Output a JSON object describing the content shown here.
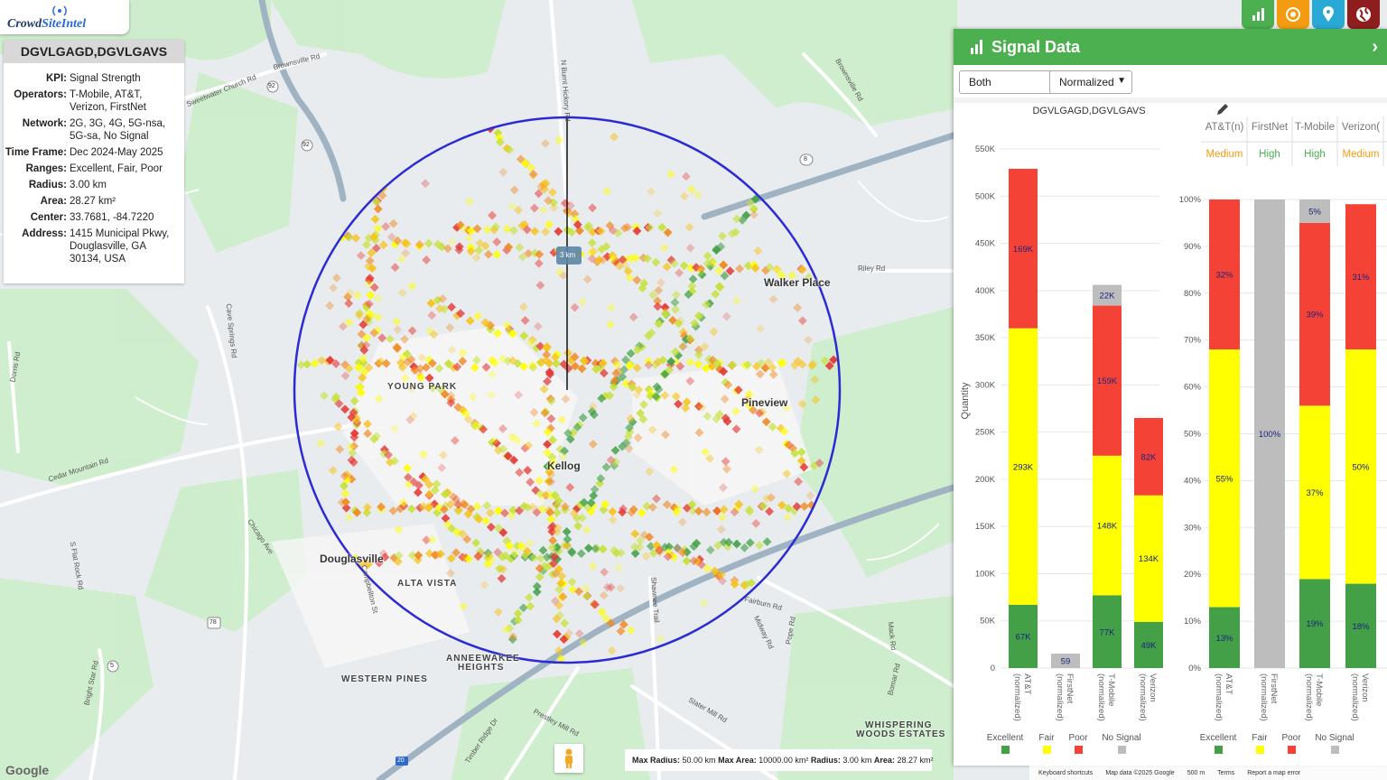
{
  "app": {
    "logo_crowd": "Crowd",
    "logo_intel": "SiteIntel"
  },
  "info": {
    "title": "DGVLGAGD,DGVLGAVS",
    "rows": [
      {
        "k": "KPI:",
        "v": "Signal Strength"
      },
      {
        "k": "Operators:",
        "v": "T-Mobile, AT&T, Verizon, FirstNet"
      },
      {
        "k": "Network:",
        "v": "2G, 3G, 4G, 5G-nsa, 5G-sa, No Signal"
      },
      {
        "k": "Time Frame:",
        "v": "Dec 2024-May 2025"
      },
      {
        "k": "Ranges:",
        "v": "Excellent, Fair, Poor"
      },
      {
        "k": "Radius:",
        "v": "3.00 km"
      },
      {
        "k": "Area:",
        "v": "28.27 km²"
      },
      {
        "k": "Center:",
        "v": "33.7681, -84.7220"
      },
      {
        "k": "Address:",
        "v": "1415 Municipal Pkwy, Douglasville, GA 30134, USA"
      }
    ]
  },
  "toolbar": {
    "icons": [
      "bar-chart-icon",
      "target-icon",
      "location-pin-icon",
      "globe-icon"
    ],
    "colors": [
      "#4caf50",
      "#f39c12",
      "#29a9d6",
      "#8e1e1e"
    ]
  },
  "map": {
    "radius_label": "3 km",
    "places": [
      {
        "name": "Walker Place"
      },
      {
        "name": "Pineview"
      },
      {
        "name": "Kellog"
      },
      {
        "name": "Douglasville"
      }
    ],
    "neighborhoods": [
      "YOUNG PARK",
      "ALTA VISTA",
      "ANNEEWAKEE",
      "HEIGHTS",
      "WESTERN PINES",
      "WHISPERING",
      "WOODS ESTATES"
    ],
    "roads": [
      "Brownsville Rd",
      "Sweetwater Church Rd",
      "N Burnt Hickory Rd",
      "Riley Rd",
      "Cave Springs Rd",
      "Dorris Rd",
      "Cedar Mountain Rd",
      "Chicago Ave",
      "S Flat Rock Rd",
      "Campbellton St",
      "Bright Star Rd",
      "Prestley Mill Rd",
      "Slater Mill Rd",
      "Fairburn Rd",
      "Midway Rd",
      "Pope Rd",
      "Mack Rd",
      "Bomar Rd",
      "Timber Ridge Dr",
      "Shawnee Trail",
      "Brownsville Rd "
    ],
    "shields": [
      "92",
      "92",
      "8",
      "78",
      "5",
      "20"
    ],
    "footer": {
      "max_radius_label": "Max Radius:",
      "max_radius": "50.00 km",
      "max_area_label": "Max Area:",
      "max_area": "10000.00 km²",
      "radius_label": "Radius:",
      "radius": "3.00 km",
      "area_label": "Area:",
      "area": "28.27 km²"
    },
    "google": "Google",
    "attribution": [
      "Keyboard shortcuts",
      "Map data ©2025 Google",
      "500 m",
      "Terms",
      "Report a map error"
    ]
  },
  "panel": {
    "title": "Signal Data",
    "select_mode": "Both",
    "select_scale": "Normalized",
    "chart_title": "DGVLGAGD,DGVLGAVS",
    "legend": [
      "Excellent",
      "Fair",
      "Poor",
      "No Signal"
    ],
    "colors": {
      "excellent": "#43a047",
      "fair": "#ffff00",
      "poor": "#f44336",
      "nosignal": "#bdbdbd"
    },
    "operators_header": [
      {
        "name": "AT&T",
        "sup": "(n)",
        "rating": "Medium",
        "color": "#f39c12"
      },
      {
        "name": "FirstNet",
        "sup": "",
        "rating": "High",
        "color": "#4caf50"
      },
      {
        "name": "T-Mobile",
        "sup": "",
        "rating": "High",
        "color": "#4caf50"
      },
      {
        "name": "Verizon",
        "sup": "(",
        "rating": "Medium",
        "color": "#f39c12"
      }
    ]
  },
  "chart_data": [
    {
      "type": "bar",
      "stacked": true,
      "title": "DGVLGAGD,DGVLGAVS",
      "ylabel": "Quantity",
      "ylim": [
        0,
        550000
      ],
      "yticks": [
        "0",
        "50K",
        "100K",
        "150K",
        "200K",
        "250K",
        "300K",
        "350K",
        "400K",
        "450K",
        "500K",
        "550K"
      ],
      "categories": [
        "AT&T (normalized)",
        "FirstNet (normalized)",
        "T-Mobile (normalized)",
        "Verizon (normalized)"
      ],
      "series": [
        {
          "name": "Excellent",
          "values": [
            67000,
            0,
            77000,
            49000
          ],
          "labels": [
            "67K",
            "",
            "77K",
            "49K"
          ]
        },
        {
          "name": "Fair",
          "values": [
            293000,
            0,
            148000,
            134000
          ],
          "labels": [
            "293K",
            "",
            "148K",
            "134K"
          ]
        },
        {
          "name": "Poor",
          "values": [
            169000,
            0,
            159000,
            82000
          ],
          "labels": [
            "169K",
            "",
            "159K",
            "82K"
          ]
        },
        {
          "name": "No Signal",
          "values": [
            0,
            59,
            22000,
            0
          ],
          "labels": [
            "",
            "59",
            "22K",
            ""
          ]
        }
      ]
    },
    {
      "type": "bar",
      "stacked": true,
      "ylim": [
        0,
        100
      ],
      "yticks": [
        "0%",
        "10%",
        "20%",
        "30%",
        "40%",
        "50%",
        "60%",
        "70%",
        "80%",
        "90%",
        "100%"
      ],
      "categories": [
        "AT&T (normalized)",
        "FirstNet (normalized)",
        "T-Mobile (normalized)",
        "Verizon (normalized)"
      ],
      "series": [
        {
          "name": "Excellent",
          "values": [
            13,
            0,
            19,
            18
          ],
          "labels": [
            "13%",
            "",
            "19%",
            "18%"
          ]
        },
        {
          "name": "Fair",
          "values": [
            55,
            0,
            37,
            50
          ],
          "labels": [
            "55%",
            "",
            "37%",
            "50%"
          ]
        },
        {
          "name": "Poor",
          "values": [
            32,
            0,
            39,
            31
          ],
          "labels": [
            "32%",
            "",
            "39%",
            "31%"
          ]
        },
        {
          "name": "No Signal",
          "values": [
            0,
            100,
            5,
            0
          ],
          "labels": [
            "",
            "100%",
            "5%",
            ""
          ]
        }
      ]
    }
  ]
}
